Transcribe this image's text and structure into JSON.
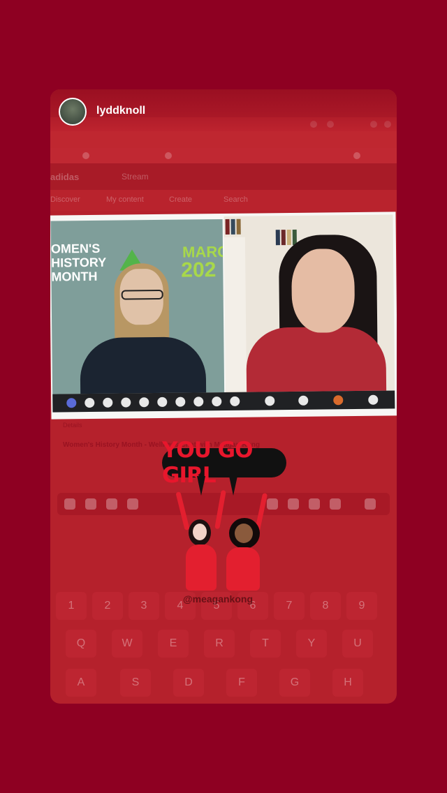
{
  "story": {
    "username": "lyddknoll",
    "mention": "@meagankong"
  },
  "browser": {
    "brand": "adidas",
    "app_name": "Stream",
    "nav_items": [
      "Discover",
      "My content",
      "Create",
      "Search"
    ]
  },
  "video_call": {
    "event_line1": "OMEN'S",
    "event_line2": "HISTORY",
    "event_line3": "MONTH",
    "event_right1": "MARC",
    "event_right2": "202"
  },
  "page_below": {
    "section_label": "Details",
    "video_title": "Women's History Month - Wellness Chat with Meagan Kong"
  },
  "sticker": {
    "text": "YOU GO GIRL"
  },
  "keyboard": {
    "row1": [
      "1",
      "2",
      "3",
      "4",
      "5",
      "6",
      "7",
      "8",
      "9"
    ],
    "row2": [
      "Q",
      "W",
      "E",
      "R",
      "T",
      "Y",
      "U"
    ],
    "row3": [
      "A",
      "S",
      "D",
      "F",
      "G",
      "H"
    ]
  }
}
